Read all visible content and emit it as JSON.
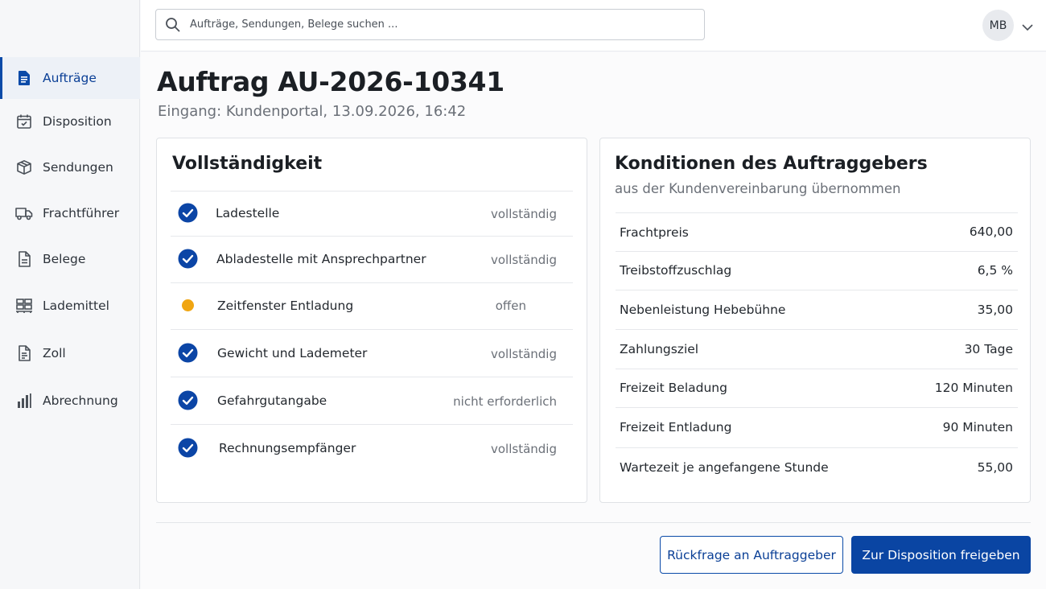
{
  "search": {
    "placeholder": "Aufträge, Sendungen, Belege suchen ..."
  },
  "user": {
    "initials": "MB"
  },
  "sidebar": {
    "items": [
      {
        "label": "Aufträge",
        "icon": "document-icon",
        "active": true
      },
      {
        "label": "Disposition",
        "icon": "calendar-icon"
      },
      {
        "label": "Sendungen",
        "icon": "box-icon"
      },
      {
        "label": "Frachtführer",
        "icon": "truck-icon"
      },
      {
        "label": "Belege",
        "icon": "file-icon"
      },
      {
        "label": "Lademittel",
        "icon": "pallet-icon"
      },
      {
        "label": "Zoll",
        "icon": "customs-document-icon"
      },
      {
        "label": "Abrechnung",
        "icon": "bar-chart-icon"
      }
    ]
  },
  "page": {
    "title": "Auftrag AU-2026-10341",
    "subtitle": "Eingang: Kundenportal, 13.09.2026, 16:42"
  },
  "completeness": {
    "title": "Vollständigkeit",
    "rows": [
      {
        "label": "Ladestelle",
        "state": "vollständig",
        "icon": "check-circle-icon"
      },
      {
        "label": "Abladestelle mit Ansprechpartner",
        "state": "vollständig",
        "icon": "check-circle-icon"
      },
      {
        "label": "Zeitfenster Entladung",
        "state": "offen",
        "icon": "pending-dot-icon"
      },
      {
        "label": "Gewicht und Lademeter",
        "state": "vollständig",
        "icon": "check-circle-icon"
      },
      {
        "label": "Gefahrgutangabe",
        "state": "nicht erforderlich",
        "icon": "check-circle-icon"
      },
      {
        "label": "Rechnungsempfänger",
        "state": "vollständig",
        "icon": "check-circle-icon"
      }
    ]
  },
  "conditions": {
    "title": "Konditionen des Auftraggebers",
    "subtitle": "aus der Kundenvereinbarung übernommen",
    "rows": [
      {
        "label": "Frachtpreis",
        "value": "640,00"
      },
      {
        "label": "Treibstoffzuschlag",
        "value": "6,5 %"
      },
      {
        "label": "Nebenleistung Hebebühne",
        "value": "35,00"
      },
      {
        "label": "Zahlungsziel",
        "value": "30 Tage"
      },
      {
        "label": "Freizeit Beladung",
        "value": "120 Minuten"
      },
      {
        "label": "Freizeit Entladung",
        "value": "90 Minuten"
      },
      {
        "label": "Wartezeit je angefangene Stunde",
        "value": "55,00"
      }
    ]
  },
  "actions": {
    "secondary_label": "Rückfrage an Auftraggeber",
    "primary_label": "Zur Disposition freigeben"
  },
  "colors": {
    "accent": "#0a4aa8",
    "check": "#0b45a6",
    "pending": "#f0a511"
  }
}
